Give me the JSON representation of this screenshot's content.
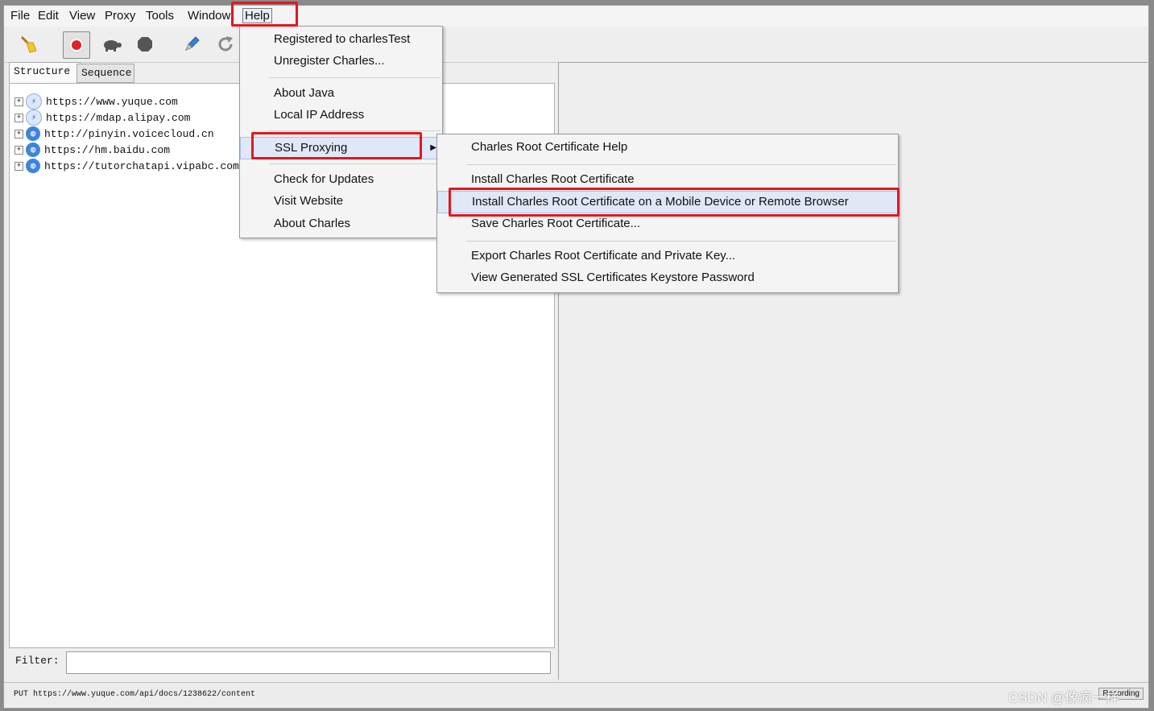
{
  "menubar": {
    "items": [
      "File",
      "Edit",
      "View",
      "Proxy",
      "Tools",
      "Window",
      "Help"
    ]
  },
  "toolbar": {
    "buttons": [
      {
        "name": "broom-icon",
        "glyph": "🧹"
      },
      {
        "name": "record-icon",
        "glyph": "●"
      },
      {
        "name": "turtle-icon",
        "glyph": "▲"
      },
      {
        "name": "stop-icon",
        "glyph": "⬢"
      },
      {
        "name": "pen-icon",
        "glyph": "✎"
      },
      {
        "name": "refresh-icon",
        "glyph": "↻"
      }
    ]
  },
  "tabs": {
    "structure": "Structure",
    "sequence": "Sequence"
  },
  "tree": {
    "hosts": [
      {
        "url": "https://www.yuque.com",
        "icon": "bolt-icon"
      },
      {
        "url": "https://mdap.alipay.com",
        "icon": "bolt-icon"
      },
      {
        "url": "http://pinyin.voicecloud.cn",
        "icon": "globe-icon"
      },
      {
        "url": "https://hm.baidu.com",
        "icon": "globe-icon"
      },
      {
        "url": "https://tutorchatapi.vipabc.com",
        "icon": "globe-icon"
      }
    ]
  },
  "filter": {
    "label": "Filter:",
    "value": ""
  },
  "status": {
    "text": "PUT https://www.yuque.com/api/docs/1238622/content",
    "badge": "Recording"
  },
  "help_menu": {
    "registered": "Registered to charlesTest",
    "unregister": "Unregister Charles...",
    "about_java": "About Java",
    "local_ip": "Local IP Address",
    "ssl_proxying": "SSL Proxying",
    "check_updates": "Check for Updates",
    "visit_website": "Visit Website",
    "about_charles": "About Charles"
  },
  "ssl_menu": {
    "root_help": "Charles Root Certificate Help",
    "install_root": "Install Charles Root Certificate",
    "install_mobile": "Install Charles Root Certificate on a Mobile Device or Remote Browser",
    "save_root": "Save Charles Root Certificate...",
    "export_root": "Export Charles Root Certificate and Private Key...",
    "view_keystore": "View Generated SSL Certificates Keystore Password"
  },
  "watermark": "CSDN @像疯一样",
  "colors": {
    "highlight_box": "#e8141e",
    "record_red": "#e02424",
    "menu_highlight": "#dfe8f6"
  }
}
